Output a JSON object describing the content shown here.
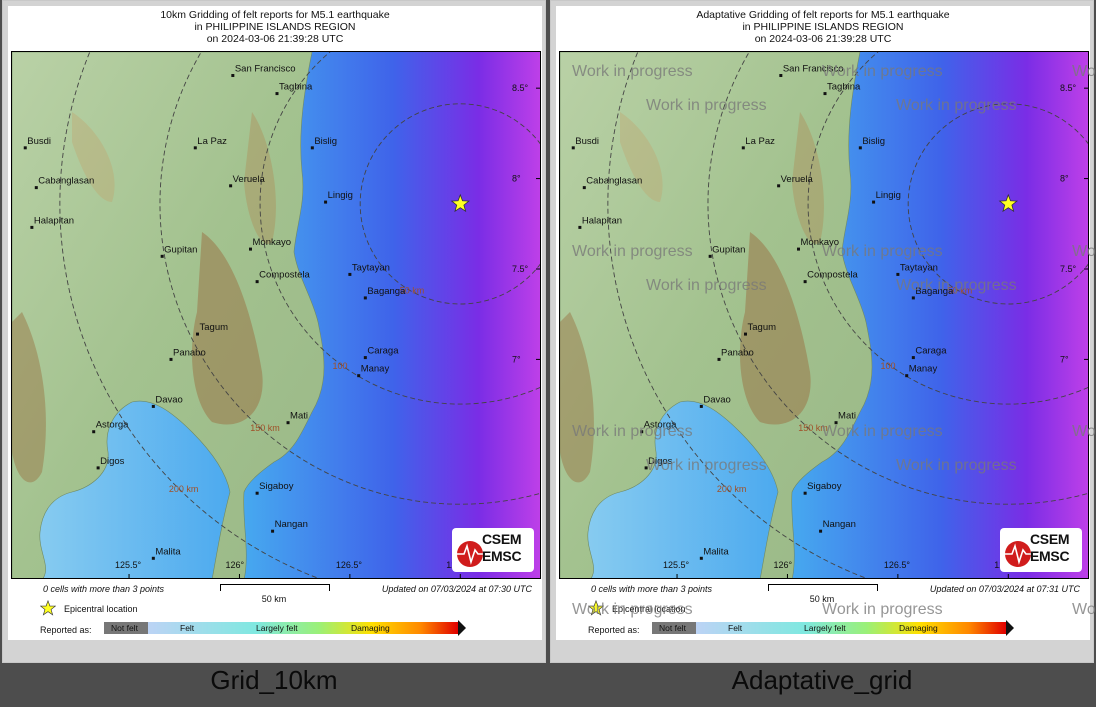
{
  "panels": [
    {
      "id": "left",
      "title_lines": [
        "10km Gridding of felt reports for M5.1 earthquake",
        "in PHILIPPINE ISLANDS REGION",
        "on  2024-03-06 21:39:28 UTC"
      ],
      "cells_note": "0 cells with more than 3 points",
      "updated": "Updated on 07/03/2024 at 07:30 UTC",
      "caption": "Grid_10km",
      "watermark": false
    },
    {
      "id": "right",
      "title_lines": [
        "Adaptative Gridding of felt reports for M5.1 earthquake",
        "in PHILIPPINE ISLANDS REGION",
        "on  2024-03-06 21:39:28 UTC"
      ],
      "cells_note": "0 cells with more than 3 points",
      "updated": "Updated on 07/03/2024 at 07:31 UTC",
      "caption": "Adaptative_grid",
      "watermark": true
    }
  ],
  "map": {
    "places": [
      {
        "name": "San Francisco",
        "lon": 125.97,
        "lat": 8.57
      },
      {
        "name": "Tagbina",
        "lon": 126.17,
        "lat": 8.47
      },
      {
        "name": "Busdi",
        "lon": 125.03,
        "lat": 8.17
      },
      {
        "name": "La Paz",
        "lon": 125.8,
        "lat": 8.17
      },
      {
        "name": "Bislig",
        "lon": 126.33,
        "lat": 8.17
      },
      {
        "name": "Cabanglasan",
        "lon": 125.08,
        "lat": 7.95
      },
      {
        "name": "Veruela",
        "lon": 125.96,
        "lat": 7.96
      },
      {
        "name": "Lingig",
        "lon": 126.39,
        "lat": 7.87
      },
      {
        "name": "Halapitan",
        "lon": 125.06,
        "lat": 7.73
      },
      {
        "name": "Monkayo",
        "lon": 126.05,
        "lat": 7.61
      },
      {
        "name": "Gupitan",
        "lon": 125.65,
        "lat": 7.57
      },
      {
        "name": "Taytayan",
        "lon": 126.5,
        "lat": 7.47
      },
      {
        "name": "Compostela",
        "lon": 126.08,
        "lat": 7.43
      },
      {
        "name": "Baganga",
        "lon": 126.57,
        "lat": 7.34
      },
      {
        "name": "Tagum",
        "lon": 125.81,
        "lat": 7.14
      },
      {
        "name": "Caraga",
        "lon": 126.57,
        "lat": 7.01
      },
      {
        "name": "Panabo",
        "lon": 125.69,
        "lat": 7.0
      },
      {
        "name": "Manay",
        "lon": 126.54,
        "lat": 6.91
      },
      {
        "name": "Davao",
        "lon": 125.61,
        "lat": 6.74
      },
      {
        "name": "Mati",
        "lon": 126.22,
        "lat": 6.65
      },
      {
        "name": "Astorga",
        "lon": 125.34,
        "lat": 6.6
      },
      {
        "name": "Digos",
        "lon": 125.36,
        "lat": 6.4
      },
      {
        "name": "Sigaboy",
        "lon": 126.08,
        "lat": 6.26
      },
      {
        "name": "Nangan",
        "lon": 126.15,
        "lat": 6.05
      },
      {
        "name": "Malita",
        "lon": 125.61,
        "lat": 5.9
      }
    ],
    "lon_ticks": [
      {
        "label": "125.5°",
        "value": 125.5
      },
      {
        "label": "126°",
        "value": 126.0
      },
      {
        "label": "126.5°",
        "value": 126.5
      },
      {
        "label": "127°",
        "value": 127.0
      }
    ],
    "lat_ticks": [
      {
        "label": "8.5°",
        "value": 8.5
      },
      {
        "label": "8°",
        "value": 8.0
      },
      {
        "label": "7.5°",
        "value": 7.5
      },
      {
        "label": "7°",
        "value": 7.0
      }
    ],
    "epicenter": {
      "lon": 127.0,
      "lat": 7.86
    },
    "distance_rings": [
      {
        "km": 50,
        "label": "50 km"
      },
      {
        "km": 100,
        "label": "100"
      },
      {
        "km": 150,
        "label": "150 km"
      },
      {
        "km": 200,
        "label": "200 km"
      }
    ]
  },
  "legend": {
    "epicentral_label": "Epicentral location",
    "reported_label": "Reported as:",
    "scale_label": "50 km",
    "categories": [
      {
        "label": "Not felt",
        "color": "#777777"
      },
      {
        "label": "Felt",
        "color": "#bcd3f5"
      },
      {
        "label": "Largely felt",
        "color": "#66e0a8"
      },
      {
        "label": "Damaging",
        "color": "#ff8800"
      }
    ]
  },
  "logo": {
    "line1": "CSEM",
    "line2": "EMSC"
  },
  "watermark_text": "Work in progress",
  "colors": {
    "sea_deep": "#7a20e8",
    "sea": "#4aa0f0",
    "land": "#a7c79a",
    "mountain": "#8f6a3e",
    "star": "#ffff22"
  }
}
